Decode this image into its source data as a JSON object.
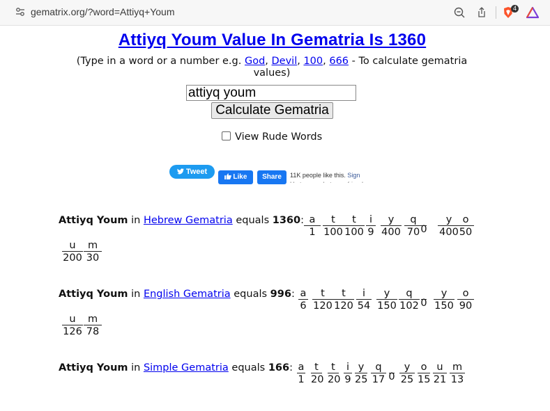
{
  "browser": {
    "url": "gematrix.org/?word=Attiyq+Youm",
    "badge_count": "4"
  },
  "page": {
    "title": "Attiyq Youm Value In Gematria Is 1360",
    "subtitle_prefix": "(Type in a word or a number e.g. ",
    "examples": [
      "God",
      "Devil",
      "100",
      "666"
    ],
    "subtitle_suffix": " - To calculate gematria values)",
    "input_value": "attiyq youm",
    "calculate_label": "Calculate Gematria",
    "rude_label": "View Rude Words"
  },
  "social": {
    "tweet_label": "Tweet",
    "like_label": "Like",
    "share_label": "Share",
    "fb_count": "11K people like this.",
    "fb_signup": "Sign",
    "fb_cut_text": "Up to see what your friends like."
  },
  "results": [
    {
      "phrase": "Attiyq Youm",
      "in": " in ",
      "system": "Hebrew Gematria",
      "equals": " equals ",
      "total": "1360",
      "letters": [
        {
          "ch": "a",
          "v": "1"
        },
        {
          "ch": "t",
          "v": "100"
        },
        {
          "ch": "t",
          "v": "100"
        },
        {
          "ch": "i",
          "v": "9"
        },
        {
          "ch": "y",
          "v": "400"
        },
        {
          "ch": "q",
          "v": "70"
        },
        {
          "ch": "",
          "v": "0"
        },
        {
          "ch": "y",
          "v": "400"
        },
        {
          "ch": "o",
          "v": "50"
        },
        {
          "ch": "u",
          "v": "200"
        },
        {
          "ch": "m",
          "v": "30"
        }
      ]
    },
    {
      "phrase": "Attiyq Youm",
      "in": " in ",
      "system": "English Gematria",
      "equals": " equals ",
      "total": "996",
      "letters": [
        {
          "ch": "a",
          "v": "6"
        },
        {
          "ch": "t",
          "v": "120"
        },
        {
          "ch": "t",
          "v": "120"
        },
        {
          "ch": "i",
          "v": "54"
        },
        {
          "ch": "y",
          "v": "150"
        },
        {
          "ch": "q",
          "v": "102"
        },
        {
          "ch": "",
          "v": "0"
        },
        {
          "ch": "y",
          "v": "150"
        },
        {
          "ch": "o",
          "v": "90"
        },
        {
          "ch": "u",
          "v": "126"
        },
        {
          "ch": "m",
          "v": "78"
        }
      ]
    },
    {
      "phrase": "Attiyq Youm",
      "in": " in ",
      "system": "Simple Gematria",
      "equals": " equals ",
      "total": "166",
      "letters": [
        {
          "ch": "a",
          "v": "1"
        },
        {
          "ch": "t",
          "v": "20"
        },
        {
          "ch": "t",
          "v": "20"
        },
        {
          "ch": "i",
          "v": "9"
        },
        {
          "ch": "y",
          "v": "25"
        },
        {
          "ch": "q",
          "v": "17"
        },
        {
          "ch": "",
          "v": "0"
        },
        {
          "ch": "y",
          "v": "25"
        },
        {
          "ch": "o",
          "v": "15"
        },
        {
          "ch": "u",
          "v": "21"
        },
        {
          "ch": "m",
          "v": "13"
        }
      ]
    }
  ]
}
